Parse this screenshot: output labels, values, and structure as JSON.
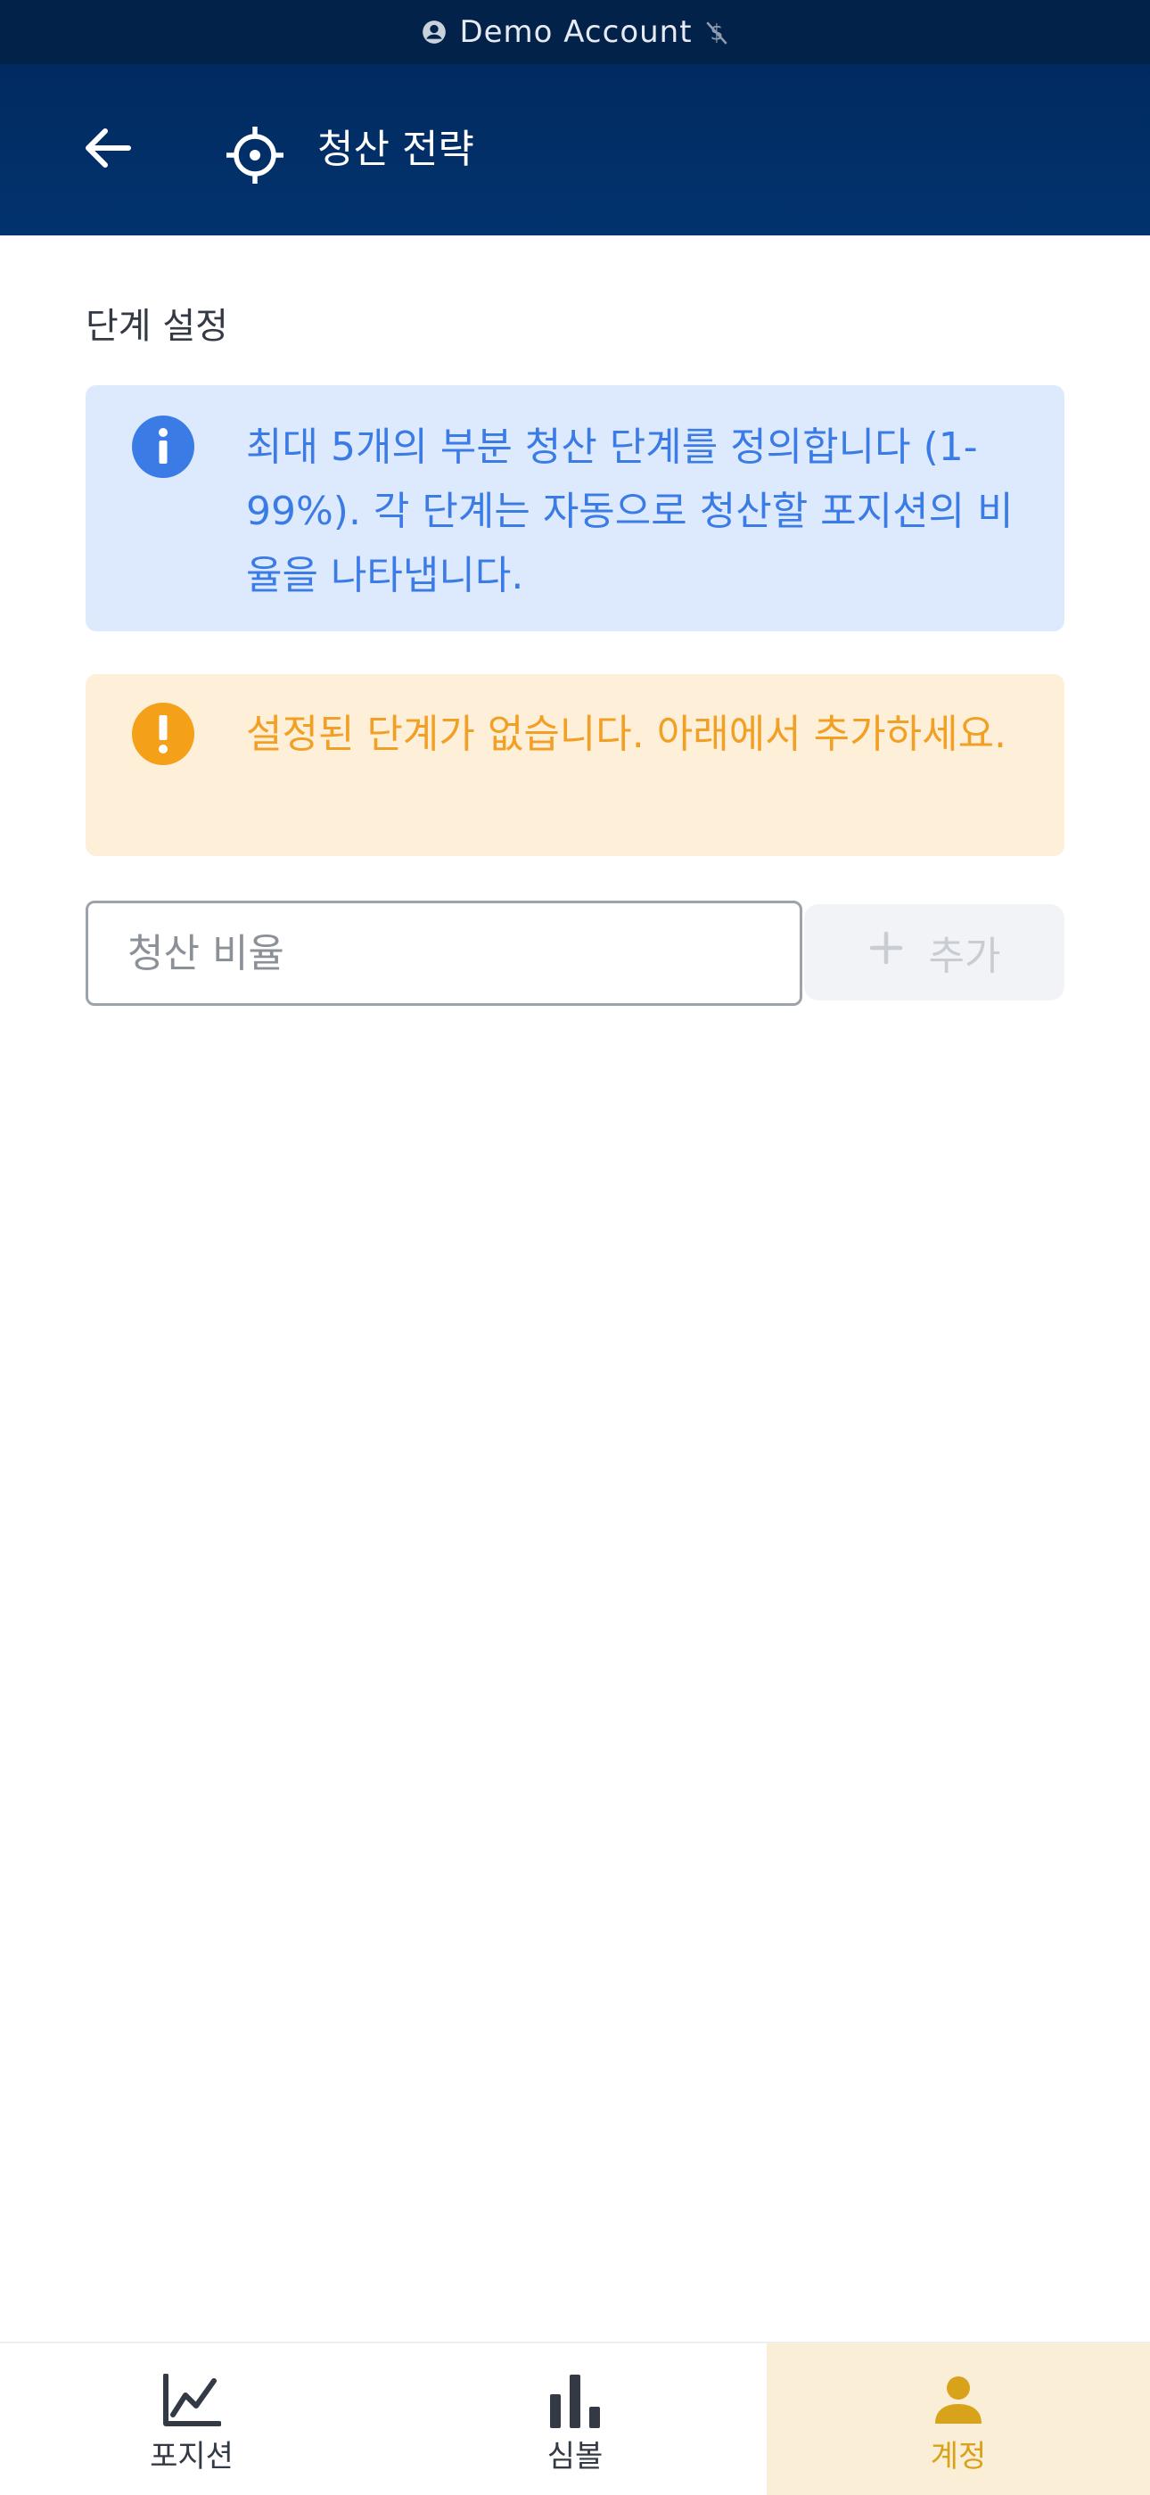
{
  "status_bar": {
    "account_label": "Demo Account",
    "icons": [
      "account-circle-icon",
      "usd-off-icon"
    ]
  },
  "header": {
    "back_icon": "arrow-left-icon",
    "title_icon": "crosshair-target-icon",
    "title": "청산 전략"
  },
  "section": {
    "label": "단계 설정"
  },
  "info_box": {
    "icon": "info-icon",
    "message": "최대 5개의 부분 청산 단계를 정의합니다 (1-99%). 각 단계는 자동으로 청산할 포지션의 비율을 나타냅니다."
  },
  "warning_box": {
    "icon": "alert-icon",
    "message": "설정된 단계가 없습니다. 아래에서 추가하세요."
  },
  "ratio_input": {
    "placeholder": "청산 비율",
    "value": ""
  },
  "add_button": {
    "icon": "plus-icon",
    "label": "추가",
    "enabled": false
  },
  "bottom_nav": {
    "items": [
      {
        "label": "포지션",
        "icon": "chart-line-icon",
        "active": false
      },
      {
        "label": "심볼",
        "icon": "bar-chart-icon",
        "active": false
      },
      {
        "label": "계정",
        "icon": "person-icon",
        "active": true
      }
    ]
  },
  "colors": {
    "header_bg": "#012a60",
    "status_bar_bg": "#03224a",
    "info_bg": "#dde9fc",
    "info_text": "#3b7be6",
    "warning_bg": "#feefd9",
    "warning_text": "#f2a025",
    "active_nav_bg": "#fbeed7",
    "active_nav_text": "#d9a21b"
  }
}
